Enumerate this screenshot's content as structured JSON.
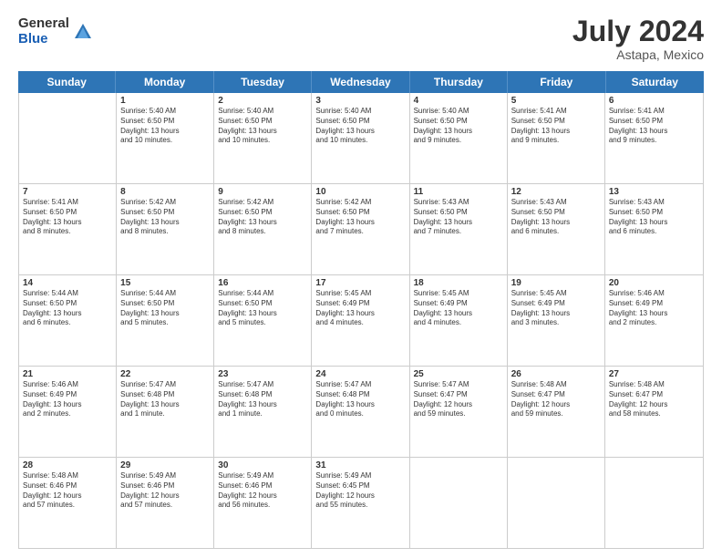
{
  "logo": {
    "general": "General",
    "blue": "Blue"
  },
  "title": {
    "month_year": "July 2024",
    "location": "Astapa, Mexico"
  },
  "header_days": [
    "Sunday",
    "Monday",
    "Tuesday",
    "Wednesday",
    "Thursday",
    "Friday",
    "Saturday"
  ],
  "weeks": [
    [
      {
        "day": "",
        "info": ""
      },
      {
        "day": "1",
        "info": "Sunrise: 5:40 AM\nSunset: 6:50 PM\nDaylight: 13 hours\nand 10 minutes."
      },
      {
        "day": "2",
        "info": "Sunrise: 5:40 AM\nSunset: 6:50 PM\nDaylight: 13 hours\nand 10 minutes."
      },
      {
        "day": "3",
        "info": "Sunrise: 5:40 AM\nSunset: 6:50 PM\nDaylight: 13 hours\nand 10 minutes."
      },
      {
        "day": "4",
        "info": "Sunrise: 5:40 AM\nSunset: 6:50 PM\nDaylight: 13 hours\nand 9 minutes."
      },
      {
        "day": "5",
        "info": "Sunrise: 5:41 AM\nSunset: 6:50 PM\nDaylight: 13 hours\nand 9 minutes."
      },
      {
        "day": "6",
        "info": "Sunrise: 5:41 AM\nSunset: 6:50 PM\nDaylight: 13 hours\nand 9 minutes."
      }
    ],
    [
      {
        "day": "7",
        "info": "Sunrise: 5:41 AM\nSunset: 6:50 PM\nDaylight: 13 hours\nand 8 minutes."
      },
      {
        "day": "8",
        "info": "Sunrise: 5:42 AM\nSunset: 6:50 PM\nDaylight: 13 hours\nand 8 minutes."
      },
      {
        "day": "9",
        "info": "Sunrise: 5:42 AM\nSunset: 6:50 PM\nDaylight: 13 hours\nand 8 minutes."
      },
      {
        "day": "10",
        "info": "Sunrise: 5:42 AM\nSunset: 6:50 PM\nDaylight: 13 hours\nand 7 minutes."
      },
      {
        "day": "11",
        "info": "Sunrise: 5:43 AM\nSunset: 6:50 PM\nDaylight: 13 hours\nand 7 minutes."
      },
      {
        "day": "12",
        "info": "Sunrise: 5:43 AM\nSunset: 6:50 PM\nDaylight: 13 hours\nand 6 minutes."
      },
      {
        "day": "13",
        "info": "Sunrise: 5:43 AM\nSunset: 6:50 PM\nDaylight: 13 hours\nand 6 minutes."
      }
    ],
    [
      {
        "day": "14",
        "info": "Sunrise: 5:44 AM\nSunset: 6:50 PM\nDaylight: 13 hours\nand 6 minutes."
      },
      {
        "day": "15",
        "info": "Sunrise: 5:44 AM\nSunset: 6:50 PM\nDaylight: 13 hours\nand 5 minutes."
      },
      {
        "day": "16",
        "info": "Sunrise: 5:44 AM\nSunset: 6:50 PM\nDaylight: 13 hours\nand 5 minutes."
      },
      {
        "day": "17",
        "info": "Sunrise: 5:45 AM\nSunset: 6:49 PM\nDaylight: 13 hours\nand 4 minutes."
      },
      {
        "day": "18",
        "info": "Sunrise: 5:45 AM\nSunset: 6:49 PM\nDaylight: 13 hours\nand 4 minutes."
      },
      {
        "day": "19",
        "info": "Sunrise: 5:45 AM\nSunset: 6:49 PM\nDaylight: 13 hours\nand 3 minutes."
      },
      {
        "day": "20",
        "info": "Sunrise: 5:46 AM\nSunset: 6:49 PM\nDaylight: 13 hours\nand 2 minutes."
      }
    ],
    [
      {
        "day": "21",
        "info": "Sunrise: 5:46 AM\nSunset: 6:49 PM\nDaylight: 13 hours\nand 2 minutes."
      },
      {
        "day": "22",
        "info": "Sunrise: 5:47 AM\nSunset: 6:48 PM\nDaylight: 13 hours\nand 1 minute."
      },
      {
        "day": "23",
        "info": "Sunrise: 5:47 AM\nSunset: 6:48 PM\nDaylight: 13 hours\nand 1 minute."
      },
      {
        "day": "24",
        "info": "Sunrise: 5:47 AM\nSunset: 6:48 PM\nDaylight: 13 hours\nand 0 minutes."
      },
      {
        "day": "25",
        "info": "Sunrise: 5:47 AM\nSunset: 6:47 PM\nDaylight: 12 hours\nand 59 minutes."
      },
      {
        "day": "26",
        "info": "Sunrise: 5:48 AM\nSunset: 6:47 PM\nDaylight: 12 hours\nand 59 minutes."
      },
      {
        "day": "27",
        "info": "Sunrise: 5:48 AM\nSunset: 6:47 PM\nDaylight: 12 hours\nand 58 minutes."
      }
    ],
    [
      {
        "day": "28",
        "info": "Sunrise: 5:48 AM\nSunset: 6:46 PM\nDaylight: 12 hours\nand 57 minutes."
      },
      {
        "day": "29",
        "info": "Sunrise: 5:49 AM\nSunset: 6:46 PM\nDaylight: 12 hours\nand 57 minutes."
      },
      {
        "day": "30",
        "info": "Sunrise: 5:49 AM\nSunset: 6:46 PM\nDaylight: 12 hours\nand 56 minutes."
      },
      {
        "day": "31",
        "info": "Sunrise: 5:49 AM\nSunset: 6:45 PM\nDaylight: 12 hours\nand 55 minutes."
      },
      {
        "day": "",
        "info": ""
      },
      {
        "day": "",
        "info": ""
      },
      {
        "day": "",
        "info": ""
      }
    ]
  ]
}
